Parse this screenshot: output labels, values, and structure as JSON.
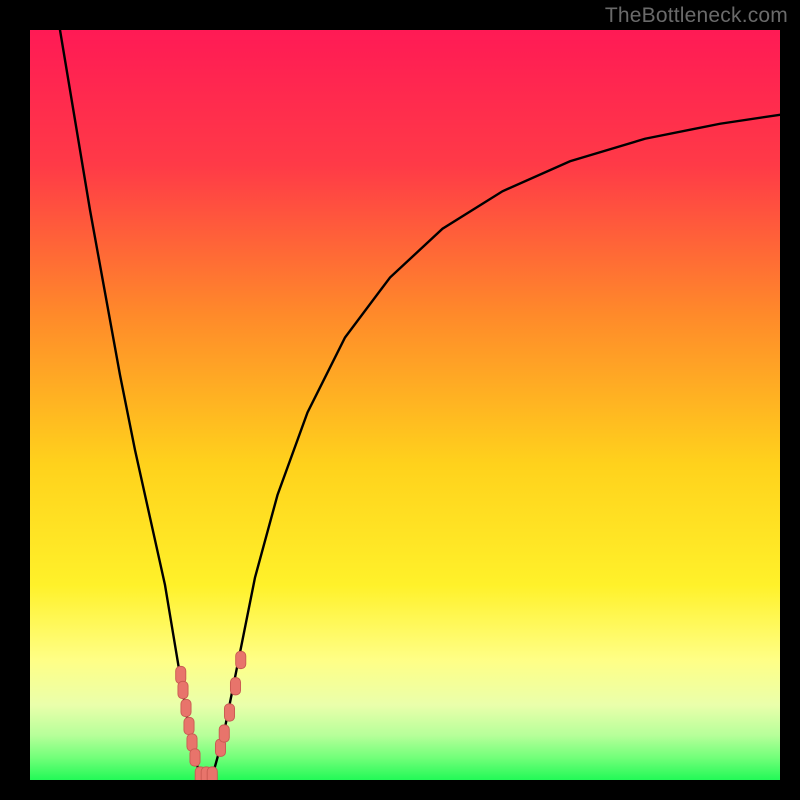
{
  "watermark": "TheBottleneck.com",
  "colors": {
    "bg_black": "#000000",
    "grad_top": "#ff1a55",
    "grad_upper": "#ff4a3a",
    "grad_mid_orange": "#ff9f1f",
    "grad_yellow": "#ffe61a",
    "grad_pale_yellow": "#ffff8a",
    "grad_pale_green": "#c6ff9a",
    "grad_green": "#2bff5e",
    "curve_stroke": "#000000",
    "marker_fill": "#e8746b",
    "marker_stroke": "#c85a52"
  },
  "chart_data": {
    "type": "line",
    "title": "",
    "xlabel": "",
    "ylabel": "",
    "xlim": [
      0,
      100
    ],
    "ylim": [
      0,
      100
    ],
    "series": [
      {
        "name": "left-branch",
        "x": [
          4,
          6,
          8,
          10,
          12,
          14,
          16,
          18,
          20,
          21,
          22,
          22.7
        ],
        "y": [
          100,
          88,
          76,
          65,
          54,
          44,
          35,
          26,
          14,
          8,
          3,
          0.5
        ]
      },
      {
        "name": "right-branch",
        "x": [
          24.3,
          25,
          26,
          28,
          30,
          33,
          37,
          42,
          48,
          55,
          63,
          72,
          82,
          92,
          100
        ],
        "y": [
          0.5,
          3,
          7,
          17,
          27,
          38,
          49,
          59,
          67,
          73.5,
          78.5,
          82.5,
          85.5,
          87.5,
          88.7
        ]
      }
    ],
    "valley_floor": {
      "x": [
        22.7,
        24.3
      ],
      "y": [
        0.5,
        0.5
      ]
    },
    "markers_left_branch": [
      {
        "x": 20.1,
        "y": 14.0
      },
      {
        "x": 20.4,
        "y": 12.0
      },
      {
        "x": 20.8,
        "y": 9.6
      },
      {
        "x": 21.2,
        "y": 7.2
      },
      {
        "x": 21.6,
        "y": 5.0
      },
      {
        "x": 22.0,
        "y": 3.0
      }
    ],
    "markers_right_branch": [
      {
        "x": 25.4,
        "y": 4.3
      },
      {
        "x": 25.9,
        "y": 6.2
      },
      {
        "x": 26.6,
        "y": 9.0
      },
      {
        "x": 27.4,
        "y": 12.5
      },
      {
        "x": 28.1,
        "y": 16.0
      }
    ],
    "markers_floor": [
      {
        "x": 22.7,
        "y": 0.6
      },
      {
        "x": 23.5,
        "y": 0.6
      },
      {
        "x": 24.3,
        "y": 0.6
      }
    ]
  }
}
